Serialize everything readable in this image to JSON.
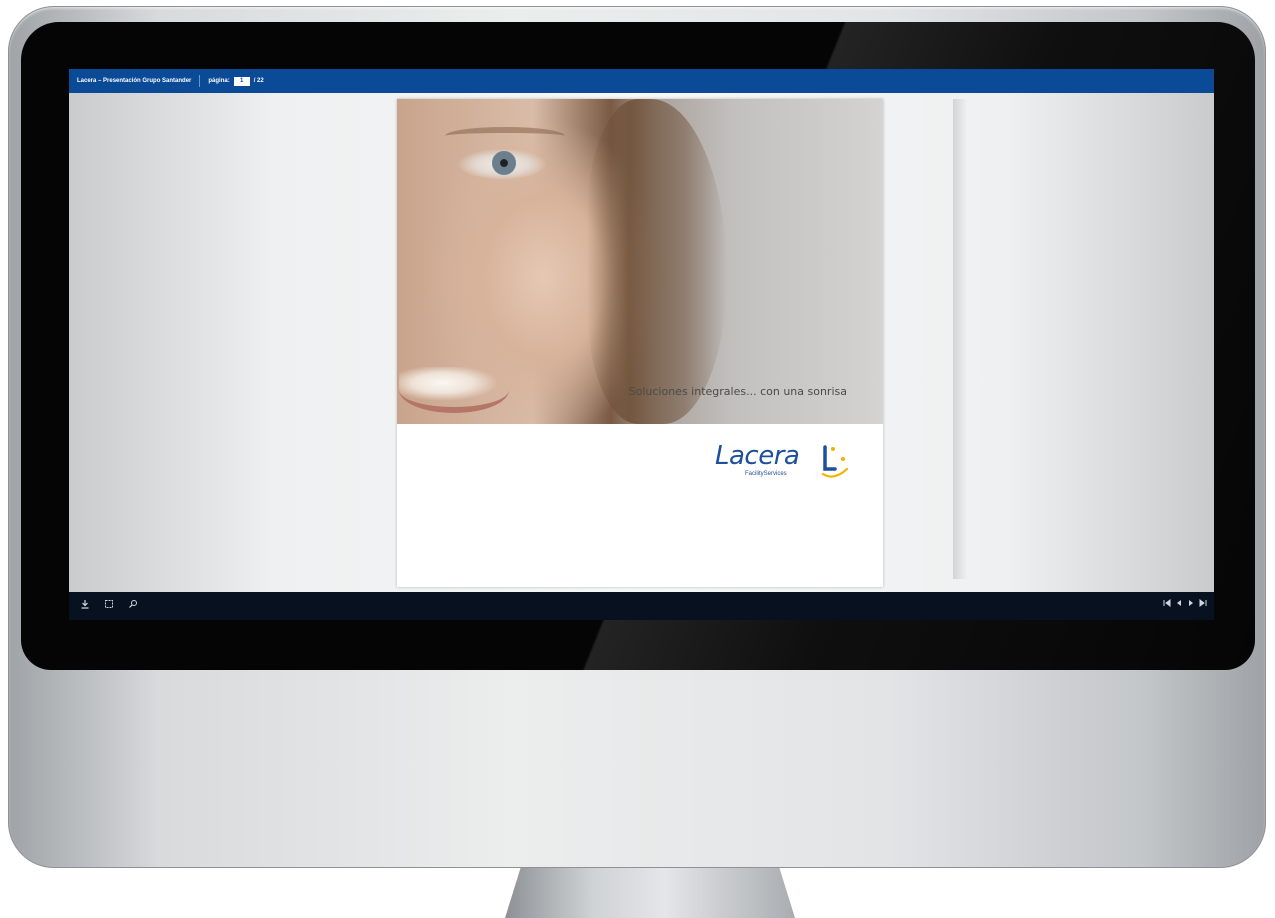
{
  "viewer": {
    "title": "Lacera – Presentación Grupo Santander",
    "page_label": "página:",
    "current_page": "1",
    "total_pages": "/ 22"
  },
  "slide": {
    "slogan": "Soluciones integrales... con una sonrisa",
    "logo_word": "Lacera",
    "logo_sub": "FacilityServices"
  },
  "toolbar": {
    "download_icon": "download-icon",
    "fit_icon": "fit-page-icon",
    "zoom_icon": "zoom-icon",
    "nav_icons": [
      "first-page-icon",
      "previous-page-icon",
      "next-page-icon",
      "last-page-icon"
    ]
  },
  "colors": {
    "topbar": "#0a4a97",
    "bottombar": "#07111f",
    "logo_blue": "#1d4f9c",
    "logo_yellow": "#f2b400"
  }
}
